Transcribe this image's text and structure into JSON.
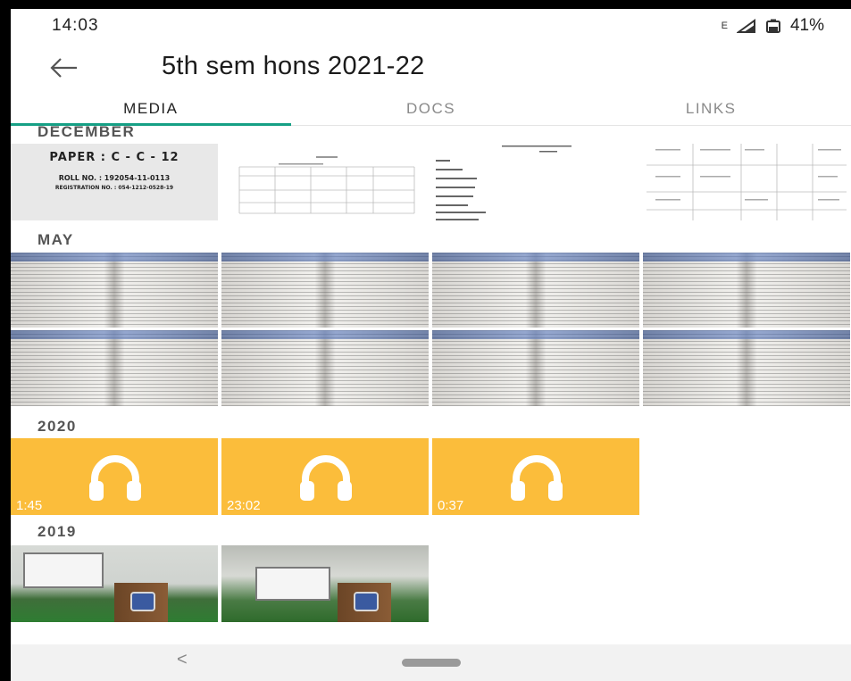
{
  "status": {
    "time": "14:03",
    "net_label": "E",
    "battery": "41%"
  },
  "header": {
    "title": "5th sem hons 2021-22"
  },
  "tabs": [
    {
      "label": "MEDIA"
    },
    {
      "label": "DOCS"
    },
    {
      "label": "LINKS"
    }
  ],
  "sections": {
    "december": {
      "label": "DECEMBER",
      "paper_thumb": {
        "line1": "PAPER : C - C - 12",
        "line2": "ROLL NO. : 192054-11-0113",
        "line3": "REGISTRATION NO. : 054-1212-0528-19"
      }
    },
    "may": {
      "label": "MAY"
    },
    "y2020": {
      "label": "2020",
      "audio": [
        {
          "duration": "1:45"
        },
        {
          "duration": "23:02"
        },
        {
          "duration": "0:37"
        }
      ]
    },
    "y2019": {
      "label": "2019"
    }
  },
  "colors": {
    "accent": "#16a085",
    "audio_tile": "#fbbd3b"
  },
  "icons": {
    "back": "arrow-left-icon",
    "audio": "headphones-icon",
    "signal": "signal-icon",
    "battery": "battery-icon"
  }
}
